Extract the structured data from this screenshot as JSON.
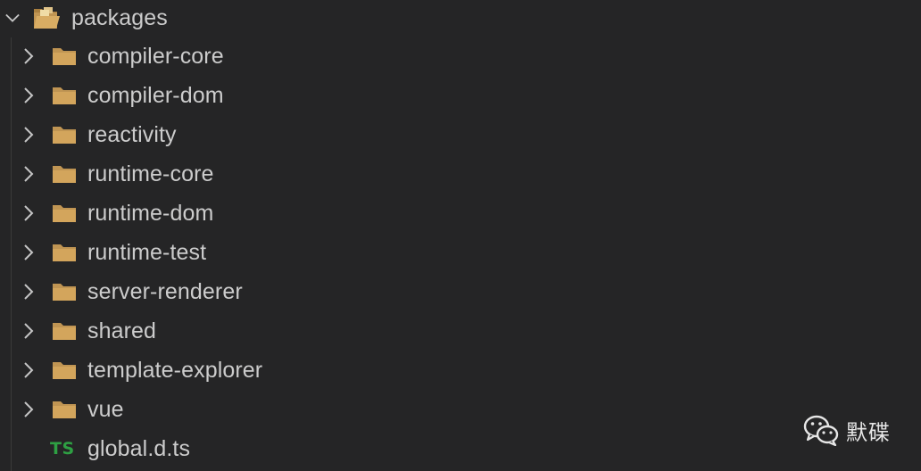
{
  "tree": {
    "root": {
      "label": "packages",
      "icon": "folder-open-icon",
      "expanded": true
    },
    "folders": [
      {
        "label": "compiler-core",
        "icon": "folder-icon"
      },
      {
        "label": "compiler-dom",
        "icon": "folder-icon"
      },
      {
        "label": "reactivity",
        "icon": "folder-icon"
      },
      {
        "label": "runtime-core",
        "icon": "folder-icon"
      },
      {
        "label": "runtime-dom",
        "icon": "folder-icon"
      },
      {
        "label": "runtime-test",
        "icon": "folder-icon"
      },
      {
        "label": "server-renderer",
        "icon": "folder-icon"
      },
      {
        "label": "shared",
        "icon": "folder-icon"
      },
      {
        "label": "template-explorer",
        "icon": "folder-icon"
      },
      {
        "label": "vue",
        "icon": "folder-icon"
      }
    ],
    "files": [
      {
        "label": "global.d.ts",
        "badge": "TS",
        "icon": "typescript-icon"
      }
    ]
  },
  "watermark": {
    "text": "默碟",
    "icon": "wechat-icon"
  },
  "colors": {
    "background": "#252526",
    "text": "#cccccc",
    "folder": "#c09553",
    "ts_badge": "#2ea043"
  }
}
